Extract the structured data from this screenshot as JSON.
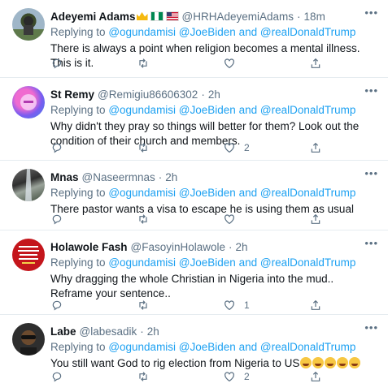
{
  "tweets": [
    {
      "name": "Adeyemi Adams",
      "handle": "@HRHAdeyemiAdams",
      "dot": "·",
      "time": "18m",
      "reply_prefix": "Replying to",
      "reply_mentions": "@ogundamisi @JoeBiden",
      "reply_and": "and",
      "reply_last": "@realDonaldTrump",
      "text": "There is always a point when religion becomes a mental illness. This is it.",
      "likes": ""
    },
    {
      "name": "St Remy",
      "handle": "@Remigiu86606302",
      "dot": "·",
      "time": "2h",
      "reply_prefix": "Replying to",
      "reply_mentions": "@ogundamisi @JoeBiden",
      "reply_and": "and",
      "reply_last": "@realDonaldTrump",
      "text": "Why didn't they pray so things will better for them? Look out the condition of their church and members.",
      "likes": "2"
    },
    {
      "name": "Mnas",
      "handle": "@Naseermnas",
      "dot": "·",
      "time": "2h",
      "reply_prefix": "Replying to",
      "reply_mentions": "@ogundamisi @JoeBiden",
      "reply_and": "and",
      "reply_last": "@realDonaldTrump",
      "text": "There pastor wants a visa to escape he is using them as usual",
      "likes": ""
    },
    {
      "name": "Holawole Fash",
      "handle": "@FasoyinHolawole",
      "dot": "·",
      "time": "2h",
      "reply_prefix": "Replying to",
      "reply_mentions": "@ogundamisi @JoeBiden",
      "reply_and": "and",
      "reply_last": "@realDonaldTrump",
      "text": "Why dragging the whole Christian in Nigeria into the mud.. Reframe your sentence..",
      "likes": "1"
    },
    {
      "name": "Labe",
      "handle": "@labesadik",
      "dot": "·",
      "time": "2h",
      "reply_prefix": "Replying to",
      "reply_mentions": "@ogundamisi @JoeBiden",
      "reply_and": "and",
      "reply_last": "@realDonaldTrump",
      "text": "You still want God to rig election from Nigeria to US",
      "likes": "2"
    }
  ],
  "icons": {
    "more": "more-icon",
    "reply": "reply-icon",
    "retweet": "retweet-icon",
    "like": "heart-icon",
    "share": "share-icon"
  },
  "colors": {
    "link": "#1da1f2",
    "muted": "#5b7083",
    "text": "#0f1419",
    "divider": "#e6ecf0"
  }
}
